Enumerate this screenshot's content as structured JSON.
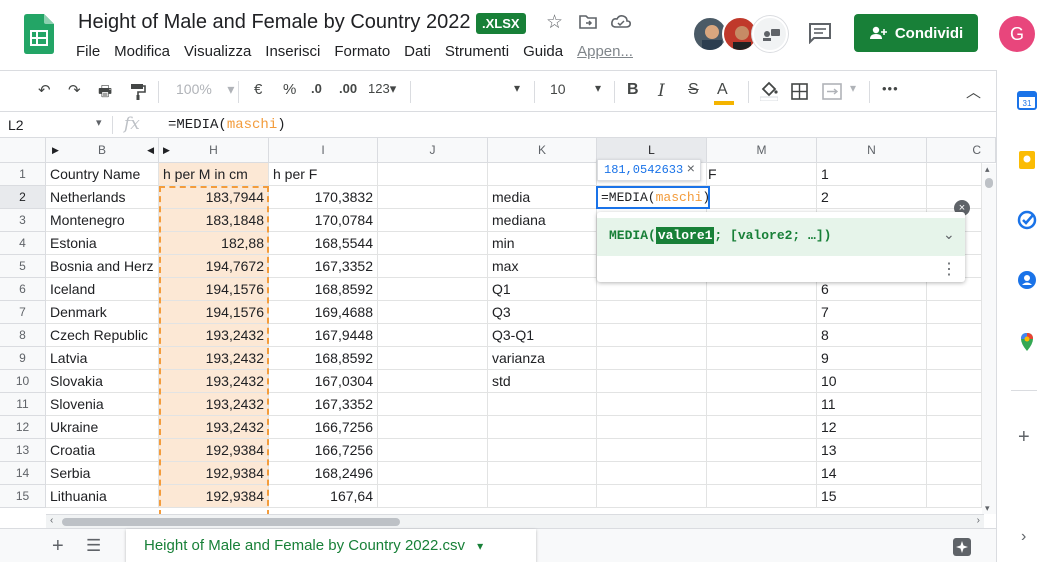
{
  "header": {
    "title": "Height of Male and Female by Country 2022",
    "badge": ".XLSX",
    "menu": [
      "File",
      "Modifica",
      "Visualizza",
      "Inserisci",
      "Formato",
      "Dati",
      "Strumenti",
      "Guida",
      "Appen..."
    ],
    "share_label": "Condividi",
    "account_initial": "G"
  },
  "toolbar": {
    "zoom": "100%",
    "currency": "€",
    "percent": "%",
    "dec_less": ".0",
    "dec_more": ".00",
    "more_formats": "123",
    "font_size": "10",
    "bold": "B",
    "italic": "I",
    "strike": "S",
    "text_color": "A",
    "more": "•••"
  },
  "formula_bar": {
    "name_box": "L2",
    "fx": "fx",
    "formula_prefix": "=MEDIA(",
    "formula_arg": "maschi",
    "formula_suffix": ")"
  },
  "columns": [
    "B",
    "H",
    "I",
    "J",
    "K",
    "L",
    "M",
    "N",
    "C"
  ],
  "rows": [
    {
      "n": "1",
      "b": "Country Name",
      "h": "h per M in cm",
      "i": "h per F",
      "k": ""
    },
    {
      "n": "2",
      "b": "Netherlands",
      "h": "183,7944",
      "i": "170,3832",
      "k": "media"
    },
    {
      "n": "3",
      "b": "Montenegro",
      "h": "183,1848",
      "i": "170,0784",
      "k": "mediana"
    },
    {
      "n": "4",
      "b": "Estonia",
      "h": "182,88",
      "i": "168,5544",
      "k": "min"
    },
    {
      "n": "5",
      "b": "Bosnia and Herz",
      "h": "194,7672",
      "i": "167,3352",
      "k": "max"
    },
    {
      "n": "6",
      "b": "Iceland",
      "h": "194,1576",
      "i": "168,8592",
      "k": "Q1"
    },
    {
      "n": "7",
      "b": "Denmark",
      "h": "194,1576",
      "i": "169,4688",
      "k": "Q3"
    },
    {
      "n": "8",
      "b": "Czech Republic",
      "h": "193,2432",
      "i": "167,9448",
      "k": "Q3-Q1"
    },
    {
      "n": "9",
      "b": "Latvia",
      "h": "193,2432",
      "i": "168,8592",
      "k": "varianza"
    },
    {
      "n": "10",
      "b": "Slovakia",
      "h": "193,2432",
      "i": "167,0304",
      "k": "std"
    },
    {
      "n": "11",
      "b": "Slovenia",
      "h": "193,2432",
      "i": "167,3352",
      "k": ""
    },
    {
      "n": "12",
      "b": "Ukraine",
      "h": "193,2432",
      "i": "166,7256",
      "k": ""
    },
    {
      "n": "13",
      "b": "Croatia",
      "h": "192,9384",
      "i": "166,7256",
      "k": ""
    },
    {
      "n": "14",
      "b": "Serbia",
      "h": "192,9384",
      "i": "168,2496",
      "k": ""
    },
    {
      "n": "15",
      "b": "Lithuania",
      "h": "192,9384",
      "i": "167,64",
      "k": ""
    }
  ],
  "m1_text": "F",
  "formula_popup": {
    "preview_value": "181,0542633",
    "preview_close": "×",
    "edit_prefix": "=MEDIA(",
    "edit_arg": "maschi",
    "edit_suffix": ")",
    "help_fn": "MEDIA(",
    "help_param": "valore1",
    "help_rest": "; [valore2; …])",
    "close": "×"
  },
  "sheet_tab": {
    "label": "Height of Male and Female by Country 2022.csv",
    "add": "+",
    "list": "☰"
  },
  "colors": {
    "accent": "#188038",
    "selection": "#1a73e8",
    "highlight": "#fce8d5",
    "range_border": "#f39c3c"
  }
}
